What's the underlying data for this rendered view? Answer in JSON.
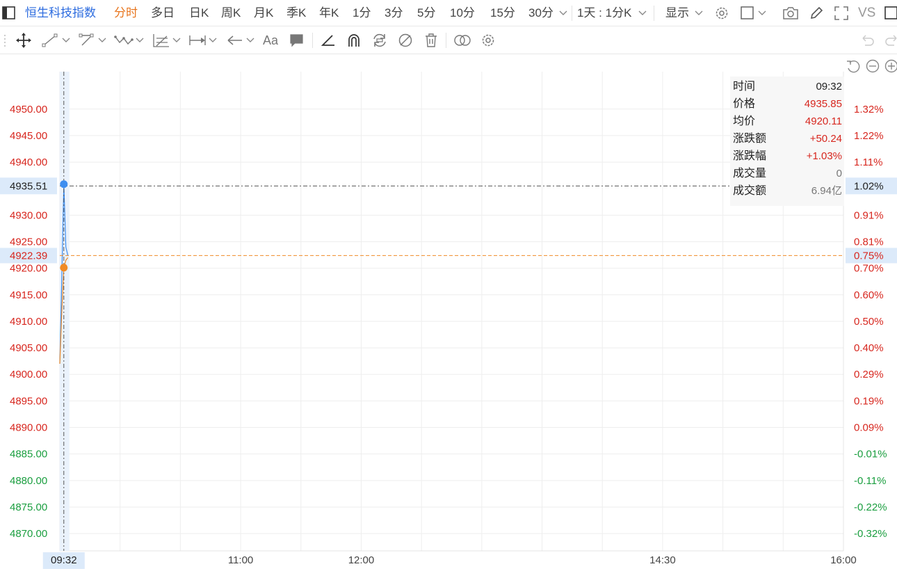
{
  "header": {
    "title": "恒生科技指数",
    "tabs": [
      "分时",
      "多日",
      "日K",
      "周K",
      "月K",
      "季K",
      "年K",
      "1分",
      "3分",
      "5分",
      "10分",
      "15分",
      "30分"
    ],
    "active_tab": "分时",
    "range_select": "1天 : 1分K",
    "display_label": "显示",
    "compare_label": "VS"
  },
  "tools": {
    "text_tool_label": "Aa"
  },
  "info_panel": [
    {
      "key": "时间",
      "value": "09:32"
    },
    {
      "key": "价格",
      "value": "4935.85"
    },
    {
      "key": "均价",
      "value": "4920.11"
    },
    {
      "key": "涨跌额",
      "value": "+50.24"
    },
    {
      "key": "涨跌幅",
      "value": "+1.03%"
    },
    {
      "key": "成交量",
      "value": "0"
    },
    {
      "key": "成交额",
      "value": "6.94亿"
    }
  ],
  "colors": {
    "up": "#d7261e",
    "down": "#1a9e3f",
    "price_line": "#3d8ef0",
    "avg_line": "#f08a24",
    "accent": "#2d6cdf"
  },
  "chart_data": {
    "type": "line",
    "ylim": [
      4867,
      4956
    ],
    "prev_close": 4885.6,
    "y_ticks": [
      {
        "value": 4950,
        "label": "4950.00",
        "pct": "1.32%"
      },
      {
        "value": 4945,
        "label": "4945.00",
        "pct": "1.22%"
      },
      {
        "value": 4940,
        "label": "4940.00",
        "pct": "1.11%"
      },
      {
        "value": 4930,
        "label": "4930.00",
        "pct": "0.91%"
      },
      {
        "value": 4925,
        "label": "4925.00",
        "pct": "0.81%"
      },
      {
        "value": 4920,
        "label": "4920.00",
        "pct": "0.70%"
      },
      {
        "value": 4915,
        "label": "4915.00",
        "pct": "0.60%"
      },
      {
        "value": 4910,
        "label": "4910.00",
        "pct": "0.50%"
      },
      {
        "value": 4905,
        "label": "4905.00",
        "pct": "0.40%"
      },
      {
        "value": 4900,
        "label": "4900.00",
        "pct": "0.29%"
      },
      {
        "value": 4895,
        "label": "4895.00",
        "pct": "0.19%"
      },
      {
        "value": 4890,
        "label": "4890.00",
        "pct": "0.09%"
      },
      {
        "value": 4885,
        "label": "4885.00",
        "pct": "-0.01%"
      },
      {
        "value": 4880,
        "label": "4880.00",
        "pct": "-0.11%"
      },
      {
        "value": 4875,
        "label": "4875.00",
        "pct": "-0.22%"
      },
      {
        "value": 4870,
        "label": "4870.00",
        "pct": "-0.32%"
      }
    ],
    "x_start": "09:30",
    "x_end": "16:00",
    "x_ticks": [
      "09:32",
      "11:00",
      "12:00",
      "14:30",
      "16:00"
    ],
    "crosshair": {
      "time": "09:32",
      "price": 4935.51,
      "price_label": "4935.51",
      "pct_label": "1.02%"
    },
    "ref_line": {
      "price": 4922.39,
      "label": "4922.39",
      "pct_label": "0.75%"
    },
    "series": [
      {
        "points": [
          [
            "09:30",
            4902.0
          ],
          [
            "09:31",
            4918.5
          ],
          [
            "09:32",
            4935.85
          ],
          [
            "09:33",
            4924.0
          ],
          [
            "09:34",
            4922.4
          ]
        ]
      },
      {
        "points": [
          [
            "09:30",
            4902.0
          ],
          [
            "09:31",
            4912.0
          ],
          [
            "09:32",
            4920.11
          ],
          [
            "09:33",
            4921.5
          ],
          [
            "09:34",
            4922.0
          ]
        ]
      }
    ]
  }
}
